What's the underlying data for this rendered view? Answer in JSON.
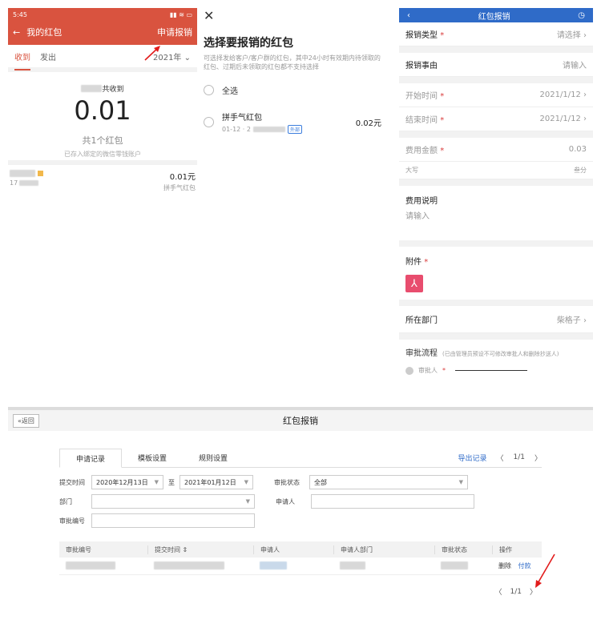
{
  "phone_app": {
    "status_time": "5:45",
    "nav_title": "我的红包",
    "action_label": "申请报销",
    "tabs": [
      "收到",
      "发出"
    ],
    "year_filter": "2021年",
    "received_label": "共收到",
    "total_amount": "0.01",
    "count_text": "共1个红包",
    "deposit_note": "已存入绑定的微信零钱账户",
    "record": {
      "date_prefix": "17",
      "amount": "0.01元",
      "type": "拼手气红包"
    }
  },
  "picker": {
    "title": "选择要报销的红包",
    "description": "可选择发给客户/客户群的红包，其中24小时有效期内待领取的红包、过期后未领取的红包都不支持选择",
    "select_all": "全选",
    "item": {
      "name": "拼手气红包",
      "meta": "01-12 · 2",
      "tag": "外部",
      "amount": "0.02元"
    }
  },
  "form": {
    "header_title": "红包报销",
    "fields": [
      {
        "label": "报销类型",
        "required": true,
        "value": "请选择"
      },
      {
        "label": "报销事由",
        "required": false,
        "value": "请输入"
      },
      {
        "label": "开始时间",
        "required": true,
        "value": "2021/1/12"
      },
      {
        "label": "结束时间",
        "required": true,
        "value": "2021/1/12"
      }
    ],
    "amount_label": "费用金额",
    "amount_value": "0.03",
    "uppercase_label": "大写",
    "uppercase_value": "叁分",
    "desc_label": "费用说明",
    "desc_placeholder": "请输入",
    "attachment_label": "附件",
    "dept_label": "所在部门",
    "dept_value": "柴格子",
    "flow_label": "审批流程",
    "flow_hint": "(已由管理员预设不可修改审批人和删除抄送人)",
    "approver_label": "审批人"
  },
  "admin": {
    "back_label": "«返回",
    "title": "红包报销",
    "tabs": [
      "申请记录",
      "模板设置",
      "规则设置"
    ],
    "export_label": "导出记录",
    "page_indicator": "1/1",
    "filters": {
      "submit_time_label": "提交时间",
      "date_from": "2020年12月13日",
      "to_label": "至",
      "date_to": "2021年01月12日",
      "status_label": "审批状态",
      "status_value": "全部",
      "dept_label": "部门",
      "applicant_label": "申请人",
      "approval_no_label": "审批编号"
    },
    "table": {
      "headers": [
        "审批编号",
        "提交时间 ⇕",
        "申请人",
        "申请人部门",
        "审批状态",
        "操作"
      ],
      "actions": [
        "删除",
        "付款"
      ]
    }
  }
}
